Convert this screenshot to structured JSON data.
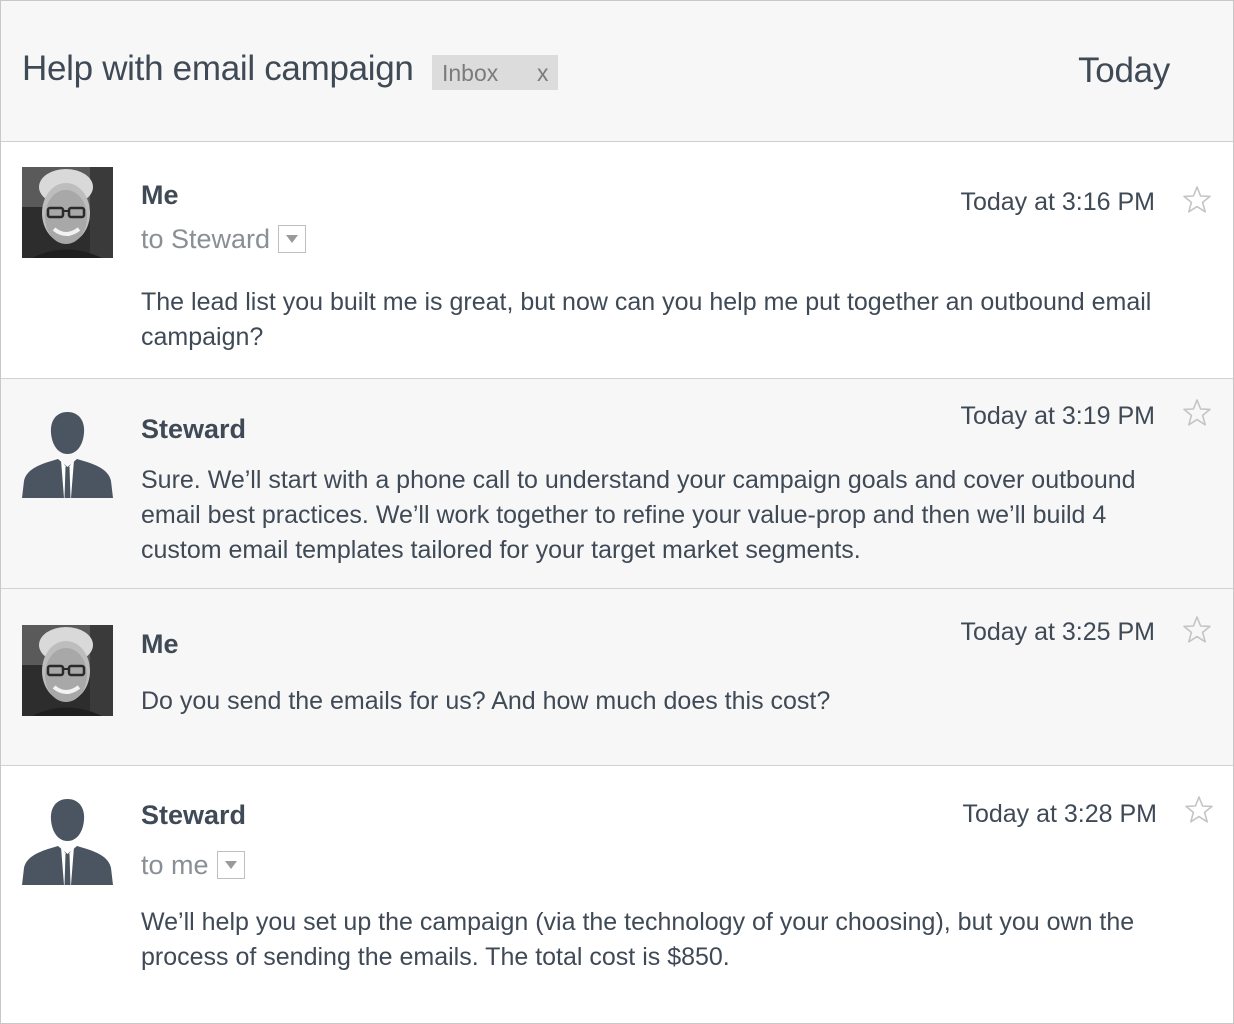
{
  "thread": {
    "subject": "Help with email campaign",
    "label": "Inbox",
    "label_close": "x",
    "date": "Today"
  },
  "messages": [
    {
      "sender": "Me",
      "recipient": "to Steward",
      "timestamp": "Today at 3:16 PM",
      "body": "The lead list you built me is great, but now can you help me put together an outbound email campaign?",
      "avatar": "photo"
    },
    {
      "sender": "Steward",
      "timestamp": "Today at 3:19 PM",
      "body": "Sure. We’ll start with a phone call to understand your campaign goals and cover outbound email best practices. We’ll work together to refine your value-prop and then we’ll build 4 custom email templates tailored for your target market segments.",
      "avatar": "silhouette"
    },
    {
      "sender": "Me",
      "timestamp": "Today at 3:25 PM",
      "body": "Do you send the emails for us? And how much does this cost?",
      "avatar": "photo"
    },
    {
      "sender": "Steward",
      "recipient": "to me",
      "timestamp": "Today at 3:28 PM",
      "body": "We’ll help you set up the campaign (via the technology of your choosing), but you own the process of sending the emails. The total cost is $850.",
      "avatar": "silhouette"
    }
  ],
  "icons": {
    "star": "star-outline-icon",
    "dropdown": "chevron-down-icon",
    "close": "close-icon"
  },
  "colors": {
    "text": "#3f4a56",
    "muted": "#8a8f95",
    "header_bg": "#f7f7f7",
    "chip_bg": "#dcdcdc",
    "silhouette": "#4a5561"
  }
}
